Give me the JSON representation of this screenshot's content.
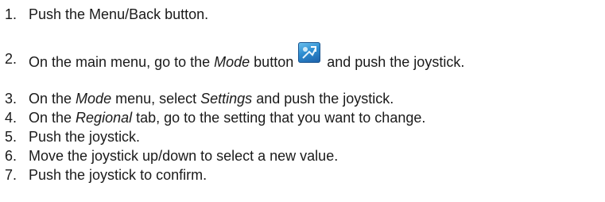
{
  "steps": [
    {
      "number": "1.",
      "parts": [
        {
          "text": "Push the Menu/Back button.",
          "italic": false
        }
      ]
    },
    {
      "number": "2.",
      "parts": [
        {
          "text": "On the main menu, go to the ",
          "italic": false
        },
        {
          "text": "Mode",
          "italic": true
        },
        {
          "text": " button",
          "italic": false
        },
        {
          "icon": "mode-icon"
        },
        {
          "text": "and push the joystick.",
          "italic": false
        }
      ]
    },
    {
      "number": "3.",
      "parts": [
        {
          "text": "On the ",
          "italic": false
        },
        {
          "text": "Mode",
          "italic": true
        },
        {
          "text": " menu, select ",
          "italic": false
        },
        {
          "text": "Settings",
          "italic": true
        },
        {
          "text": " and push the joystick.",
          "italic": false
        }
      ]
    },
    {
      "number": "4.",
      "parts": [
        {
          "text": "On the ",
          "italic": false
        },
        {
          "text": "Regional",
          "italic": true
        },
        {
          "text": " tab, go to the setting that you want to change.",
          "italic": false
        }
      ]
    },
    {
      "number": "5.",
      "parts": [
        {
          "text": "Push the joystick.",
          "italic": false
        }
      ]
    },
    {
      "number": "6.",
      "parts": [
        {
          "text": "Move the joystick up/down to select a new value.",
          "italic": false
        }
      ]
    },
    {
      "number": "7.",
      "parts": [
        {
          "text": "Push the joystick to confirm.",
          "italic": false
        }
      ]
    }
  ]
}
